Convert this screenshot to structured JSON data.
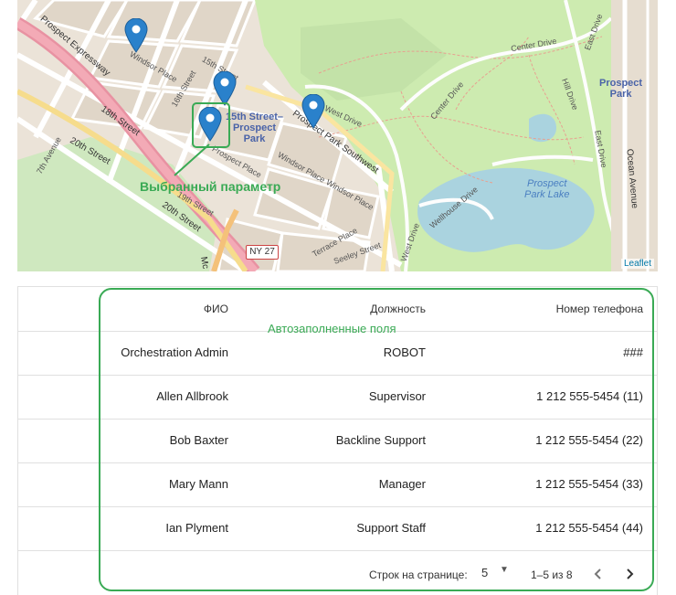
{
  "map": {
    "streets": {
      "prospect_expressway": "Prospect Expressway",
      "street_18": "18th Street",
      "street_20": "20th Street",
      "street_20b": "20th Street",
      "street_19": "19th Street",
      "avenue_7": "7th Avenue",
      "windsor_place_1": "Windsor Place",
      "windsor_place_2": "Windsor Place",
      "windsor_place_3": "Windsor Place",
      "street_15": "15th Street",
      "street_16": "16th Street",
      "prospect_place": "Prospect Place",
      "prospect_park_sw": "Prospect Park Southwest",
      "west_drive": "West Drive",
      "center_drive": "Center Drive",
      "center_drive_2": "Center Drive",
      "east_drive": "East Drive",
      "hill_drive": "Hill Drive",
      "east_drive_2": "East Drive",
      "ocean_avenue": "Ocean Avenue",
      "wellhouse_drive": "Wellhouse Drive",
      "west_drive_2": "West Drive",
      "terrace_place": "Terrace Place",
      "seeley_street": "Seeley Street",
      "mc": "Mc",
      "ny27": "NY 27"
    },
    "places": {
      "station": "15th Street–\nProspect\nPark",
      "prospect_park": "Prospect\nPark",
      "lake": "Prospect\nPark Lake"
    },
    "annotation": "Выбранный параметр",
    "attribution": "Leaflet"
  },
  "table": {
    "autofill_label": "Автозаполненные поля",
    "columns": [
      "ФИО",
      "Должность",
      "Номер телефона"
    ],
    "rows": [
      {
        "name": "Orchestration Admin",
        "position": "ROBOT",
        "phone": "###"
      },
      {
        "name": "Allen Allbrook",
        "position": "Supervisor",
        "phone": "1 212 555-5454 (11)"
      },
      {
        "name": "Bob Baxter",
        "position": "Backline Support",
        "phone": "1 212 555-5454 (22)"
      },
      {
        "name": "Mary Mann",
        "position": "Manager",
        "phone": "1 212 555-5454 (33)"
      },
      {
        "name": "Ian Plyment",
        "position": "Support Staff",
        "phone": "1 212 555-5454 (44)"
      }
    ],
    "pagination": {
      "rows_per_page_label": "Строк на странице:",
      "rows_per_page": "5",
      "range": "1–5 из 8"
    }
  },
  "colors": {
    "annotation": "#3aaa55",
    "marker": "#2a81cb",
    "park": "#cdebb0",
    "water": "#aad3df"
  }
}
